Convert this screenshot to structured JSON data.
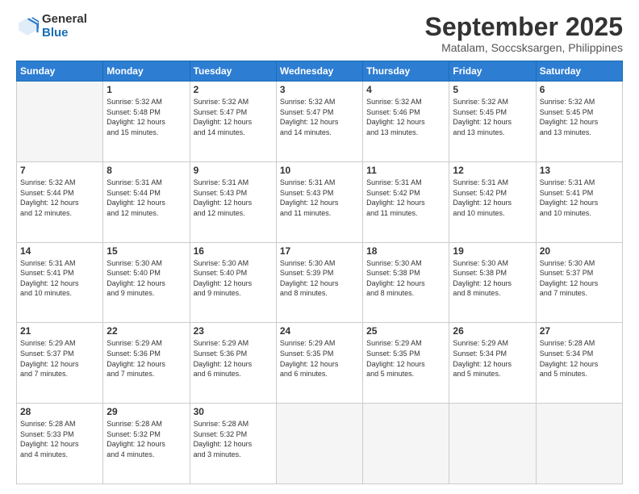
{
  "logo": {
    "general": "General",
    "blue": "Blue"
  },
  "header": {
    "title": "September 2025",
    "subtitle": "Matalam, Soccsksargen, Philippines"
  },
  "weekdays": [
    "Sunday",
    "Monday",
    "Tuesday",
    "Wednesday",
    "Thursday",
    "Friday",
    "Saturday"
  ],
  "weeks": [
    [
      {
        "date": "",
        "info": ""
      },
      {
        "date": "1",
        "info": "Sunrise: 5:32 AM\nSunset: 5:48 PM\nDaylight: 12 hours\nand 15 minutes."
      },
      {
        "date": "2",
        "info": "Sunrise: 5:32 AM\nSunset: 5:47 PM\nDaylight: 12 hours\nand 14 minutes."
      },
      {
        "date": "3",
        "info": "Sunrise: 5:32 AM\nSunset: 5:47 PM\nDaylight: 12 hours\nand 14 minutes."
      },
      {
        "date": "4",
        "info": "Sunrise: 5:32 AM\nSunset: 5:46 PM\nDaylight: 12 hours\nand 13 minutes."
      },
      {
        "date": "5",
        "info": "Sunrise: 5:32 AM\nSunset: 5:45 PM\nDaylight: 12 hours\nand 13 minutes."
      },
      {
        "date": "6",
        "info": "Sunrise: 5:32 AM\nSunset: 5:45 PM\nDaylight: 12 hours\nand 13 minutes."
      }
    ],
    [
      {
        "date": "7",
        "info": "Sunrise: 5:32 AM\nSunset: 5:44 PM\nDaylight: 12 hours\nand 12 minutes."
      },
      {
        "date": "8",
        "info": "Sunrise: 5:31 AM\nSunset: 5:44 PM\nDaylight: 12 hours\nand 12 minutes."
      },
      {
        "date": "9",
        "info": "Sunrise: 5:31 AM\nSunset: 5:43 PM\nDaylight: 12 hours\nand 12 minutes."
      },
      {
        "date": "10",
        "info": "Sunrise: 5:31 AM\nSunset: 5:43 PM\nDaylight: 12 hours\nand 11 minutes."
      },
      {
        "date": "11",
        "info": "Sunrise: 5:31 AM\nSunset: 5:42 PM\nDaylight: 12 hours\nand 11 minutes."
      },
      {
        "date": "12",
        "info": "Sunrise: 5:31 AM\nSunset: 5:42 PM\nDaylight: 12 hours\nand 10 minutes."
      },
      {
        "date": "13",
        "info": "Sunrise: 5:31 AM\nSunset: 5:41 PM\nDaylight: 12 hours\nand 10 minutes."
      }
    ],
    [
      {
        "date": "14",
        "info": "Sunrise: 5:31 AM\nSunset: 5:41 PM\nDaylight: 12 hours\nand 10 minutes."
      },
      {
        "date": "15",
        "info": "Sunrise: 5:30 AM\nSunset: 5:40 PM\nDaylight: 12 hours\nand 9 minutes."
      },
      {
        "date": "16",
        "info": "Sunrise: 5:30 AM\nSunset: 5:40 PM\nDaylight: 12 hours\nand 9 minutes."
      },
      {
        "date": "17",
        "info": "Sunrise: 5:30 AM\nSunset: 5:39 PM\nDaylight: 12 hours\nand 8 minutes."
      },
      {
        "date": "18",
        "info": "Sunrise: 5:30 AM\nSunset: 5:38 PM\nDaylight: 12 hours\nand 8 minutes."
      },
      {
        "date": "19",
        "info": "Sunrise: 5:30 AM\nSunset: 5:38 PM\nDaylight: 12 hours\nand 8 minutes."
      },
      {
        "date": "20",
        "info": "Sunrise: 5:30 AM\nSunset: 5:37 PM\nDaylight: 12 hours\nand 7 minutes."
      }
    ],
    [
      {
        "date": "21",
        "info": "Sunrise: 5:29 AM\nSunset: 5:37 PM\nDaylight: 12 hours\nand 7 minutes."
      },
      {
        "date": "22",
        "info": "Sunrise: 5:29 AM\nSunset: 5:36 PM\nDaylight: 12 hours\nand 7 minutes."
      },
      {
        "date": "23",
        "info": "Sunrise: 5:29 AM\nSunset: 5:36 PM\nDaylight: 12 hours\nand 6 minutes."
      },
      {
        "date": "24",
        "info": "Sunrise: 5:29 AM\nSunset: 5:35 PM\nDaylight: 12 hours\nand 6 minutes."
      },
      {
        "date": "25",
        "info": "Sunrise: 5:29 AM\nSunset: 5:35 PM\nDaylight: 12 hours\nand 5 minutes."
      },
      {
        "date": "26",
        "info": "Sunrise: 5:29 AM\nSunset: 5:34 PM\nDaylight: 12 hours\nand 5 minutes."
      },
      {
        "date": "27",
        "info": "Sunrise: 5:28 AM\nSunset: 5:34 PM\nDaylight: 12 hours\nand 5 minutes."
      }
    ],
    [
      {
        "date": "28",
        "info": "Sunrise: 5:28 AM\nSunset: 5:33 PM\nDaylight: 12 hours\nand 4 minutes."
      },
      {
        "date": "29",
        "info": "Sunrise: 5:28 AM\nSunset: 5:32 PM\nDaylight: 12 hours\nand 4 minutes."
      },
      {
        "date": "30",
        "info": "Sunrise: 5:28 AM\nSunset: 5:32 PM\nDaylight: 12 hours\nand 3 minutes."
      },
      {
        "date": "",
        "info": ""
      },
      {
        "date": "",
        "info": ""
      },
      {
        "date": "",
        "info": ""
      },
      {
        "date": "",
        "info": ""
      }
    ]
  ]
}
